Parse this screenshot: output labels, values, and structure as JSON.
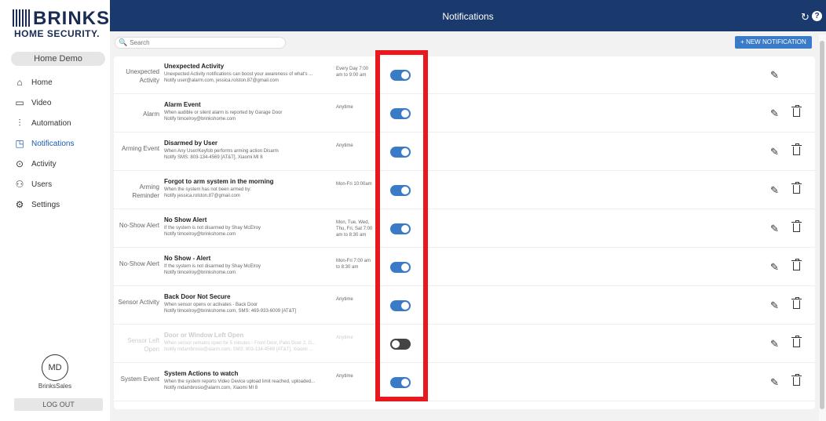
{
  "brand": {
    "name": "BRINKS",
    "subtitle": "HOME SECURITY."
  },
  "account": {
    "name": "Home Demo"
  },
  "nav": [
    {
      "label": "Home",
      "icon": "home-icon"
    },
    {
      "label": "Video",
      "icon": "video-icon"
    },
    {
      "label": "Automation",
      "icon": "automation-icon"
    },
    {
      "label": "Notifications",
      "icon": "bell-icon",
      "active": true
    },
    {
      "label": "Activity",
      "icon": "activity-icon"
    },
    {
      "label": "Users",
      "icon": "users-icon"
    },
    {
      "label": "Settings",
      "icon": "gear-icon"
    }
  ],
  "user": {
    "initials": "MD",
    "name": "BrinksSales",
    "logout_label": "LOG OUT"
  },
  "header": {
    "title": "Notifications"
  },
  "search": {
    "placeholder": "Search"
  },
  "new_button": {
    "label": "+ NEW NOTIFICATION"
  },
  "colors": {
    "header_bg": "#1a3a6e",
    "accent": "#3a7bc8",
    "highlight": "#e8191e"
  },
  "notifications": [
    {
      "category": "Unexpected Activity",
      "name": "Unexpected Activity",
      "description": "Unexpected Activity notifications can boost your awareness of what's ...",
      "notify": "Notify user@alarm.com, jessica.rolston.87@gmail.com",
      "schedule": "Every Day 7:00 am to 9:00 am",
      "enabled": true,
      "deletable": false
    },
    {
      "category": "Alarm",
      "name": "Alarm Event",
      "description": "When audible or silent alarm is reported by Garage Door",
      "notify": "Notify timcelroy@brinkshome.com",
      "schedule": "Anytime",
      "enabled": true,
      "deletable": true
    },
    {
      "category": "Arming Event",
      "name": "Disarmed by User",
      "description": "When Any User/Keyfob performs arming action Disarm",
      "notify": "Notify SMS: 803-134-4569 [AT&T], Xiaomi MI 8",
      "schedule": "Anytime",
      "enabled": true,
      "deletable": true
    },
    {
      "category": "Arming Reminder",
      "name": "Forgot to arm system in the morning",
      "description": "When the system has not been armed by:",
      "notify": "Notify jessica.rolston.87@gmail.com",
      "schedule": "Mon-Fri 10:00am",
      "enabled": true,
      "deletable": true
    },
    {
      "category": "No-Show Alert",
      "name": "No Show Alert",
      "description": "If the system is not disarmed by Shay McElroy",
      "notify": "Notify timcelroy@brinkshome.com",
      "schedule": "Mon, Tue, Wed, Thu, Fri, Sat 7:00 am to 8:30 am",
      "enabled": true,
      "deletable": true
    },
    {
      "category": "No-Show Alert",
      "name": "No Show - Alert",
      "description": "If the system is not disarmed by Shay McElroy",
      "notify": "Notify timcelroy@brinkshome.com",
      "schedule": "Mon-Fri 7:00 am to 8:30 am",
      "enabled": true,
      "deletable": true
    },
    {
      "category": "Sensor Activity",
      "name": "Back Door Not Secure",
      "description": "When sensor opens or activates - Back Door",
      "notify": "Notify timcelroy@brinkshome.com, SMS: 469-933-6009 [AT&T]",
      "schedule": "Anytime",
      "enabled": true,
      "deletable": true
    },
    {
      "category": "Sensor Left Open",
      "name": "Door or Window Left Open",
      "description": "When sensor remains open for 5 minutes - Front Door, Patio Door 2, G...",
      "notify": "Notify mdambrosio@alarm.com, SMS: 803-134-4569 [AT&T], Xiaomi ...",
      "schedule": "Anytime",
      "enabled": false,
      "deletable": true
    },
    {
      "category": "System Event",
      "name": "System Actions to watch",
      "description": "When the system reports Video Device upload limit reached, uploaded...",
      "notify": "Notify mdambrosio@alarm.com, Xiaomi MI 8",
      "schedule": "Anytime",
      "enabled": true,
      "deletable": true
    }
  ]
}
